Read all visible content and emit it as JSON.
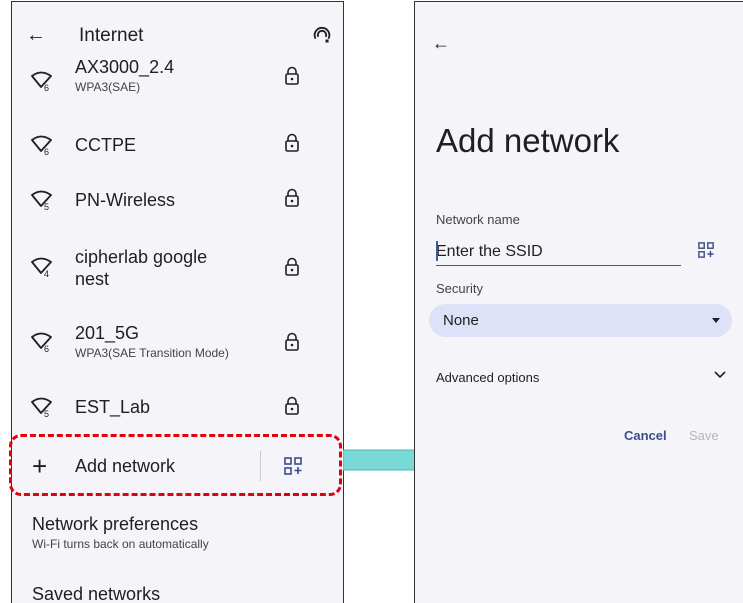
{
  "left": {
    "title": "Internet",
    "networks": [
      {
        "name": "AX3000_2.4",
        "sub": "WPA3(SAE)",
        "signal": "6"
      },
      {
        "name": "CCTPE",
        "sub": "",
        "signal": "6"
      },
      {
        "name": "PN-Wireless",
        "sub": "",
        "signal": "5"
      },
      {
        "name": "cipherlab google",
        "name2": "nest",
        "sub": "",
        "signal": "4"
      },
      {
        "name": "201_5G",
        "sub": "WPA3(SAE Transition Mode)",
        "signal": "6"
      },
      {
        "name": "EST_Lab",
        "sub": "",
        "signal": "5"
      }
    ],
    "add_network": "Add network",
    "preferences_title": "Network preferences",
    "preferences_sub": "Wi-Fi turns back on automatically",
    "saved_networks": "Saved networks"
  },
  "right": {
    "title": "Add network",
    "network_name_label": "Network name",
    "ssid_placeholder": "Enter the SSID",
    "security_label": "Security",
    "security_value": "None",
    "advanced_options": "Advanced options",
    "cancel": "Cancel",
    "save": "Save"
  },
  "colors": {
    "accent": "#3a4f8a",
    "highlight_border": "#e2000f",
    "arrow": "#79d9d6",
    "select_bg": "#dde2f8",
    "panel_bg": "#f4f4f9"
  }
}
